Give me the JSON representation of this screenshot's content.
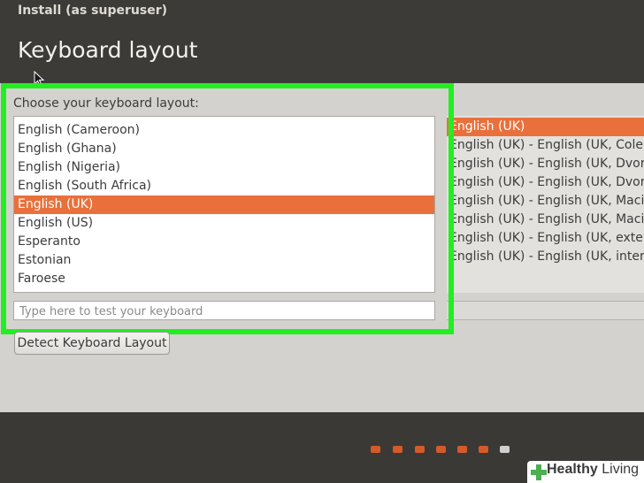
{
  "window": {
    "title": "Install (as superuser)"
  },
  "page": {
    "title": "Keyboard layout"
  },
  "layout_chooser": {
    "label": "Choose your keyboard layout:",
    "layouts": [
      "English (Cameroon)",
      "English (Ghana)",
      "English (Nigeria)",
      "English (South Africa)",
      "English (UK)",
      "English (US)",
      "Esperanto",
      "Estonian",
      "Faroese"
    ],
    "selected_layout": "English (UK)"
  },
  "variant_chooser": {
    "variants": [
      "English (UK)",
      "English (UK) - English (UK, Colem",
      "English (UK) - English (UK, Dvora",
      "English (UK) - English (UK, Dvora",
      "English (UK) - English (UK, Macin",
      "English (UK) - English (UK, Macin",
      "English (UK) - English (UK, exten",
      "English (UK) - English (UK, intern"
    ],
    "selected_variant": "English (UK)"
  },
  "test_input": {
    "placeholder": "Type here to test your keyboard",
    "value": ""
  },
  "detect_button": {
    "label": "Detect Keyboard Layout"
  },
  "progress": {
    "total_steps": 7,
    "current_step": 7
  },
  "watermark": {
    "text_bold": "Healthy",
    "text_light": "Living"
  },
  "colors": {
    "selection": "#e9703b",
    "highlight_border": "#22ee22",
    "chrome_dark": "#3c3b37",
    "step_dot": "#d45a2a"
  }
}
